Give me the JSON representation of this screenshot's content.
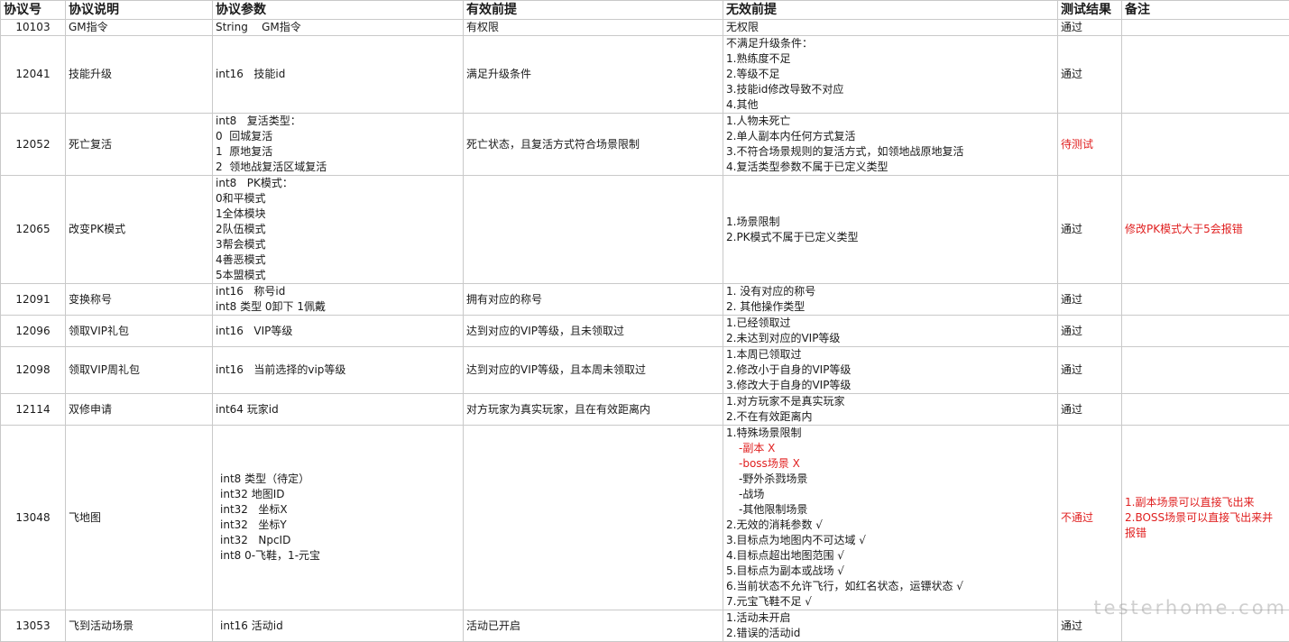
{
  "headers": [
    "协议号",
    "协议说明",
    "协议参数",
    "有效前提",
    "无效前提",
    "测试结果",
    "备注"
  ],
  "rows": [
    {
      "id": "10103",
      "desc": "GM指令",
      "params": [
        "String    GM指令"
      ],
      "valid": "有权限",
      "invalid": [
        "无权限"
      ],
      "result": "通过",
      "note": []
    },
    {
      "id": "12041",
      "desc": "技能升级",
      "params": [
        "int16   技能id"
      ],
      "valid": "满足升级条件",
      "invalid": [
        "不满足升级条件：",
        "1.熟练度不足",
        "2.等级不足",
        "3.技能id修改导致不对应",
        "4.其他"
      ],
      "result": "通过",
      "note": []
    },
    {
      "id": "12052",
      "desc": "死亡复活",
      "params": [
        "int8   复活类型：",
        "0  回城复活",
        "1  原地复活",
        "2  领地战复活区域复活"
      ],
      "valid": "死亡状态，且复活方式符合场景限制",
      "invalid": [
        "1.人物未死亡",
        "2.单人副本内任何方式复活",
        "3.不符合场景规则的复活方式，如领地战原地复活",
        "4.复活类型参数不属于已定义类型"
      ],
      "result": "待测试",
      "note": []
    },
    {
      "id": "12065",
      "desc": "改变PK模式",
      "params": [
        "int8   PK模式：",
        "0和平模式",
        "1全体模块",
        "2队伍模式",
        "3帮会模式",
        "4善恶模式",
        "5本盟模式"
      ],
      "valid": "",
      "invalid": [
        "1.场景限制",
        "2.PK模式不属于已定义类型"
      ],
      "result": "通过",
      "note": [
        "修改PK模式大于5会报错"
      ]
    },
    {
      "id": "12091",
      "desc": "变换称号",
      "params": [
        "int16   称号id",
        "int8 类型 0卸下 1佩戴"
      ],
      "valid": "拥有对应的称号",
      "invalid": [
        "1. 没有对应的称号",
        "2. 其他操作类型"
      ],
      "result": "通过",
      "note": []
    },
    {
      "id": "12096",
      "desc": "领取VIP礼包",
      "params": [
        "int16   VIP等级"
      ],
      "valid": "达到对应的VIP等级，且未领取过",
      "invalid": [
        "1.已经领取过",
        "2.未达到对应的VIP等级"
      ],
      "result": "通过",
      "note": []
    },
    {
      "id": "12098",
      "desc": "领取VIP周礼包",
      "params": [
        "int16   当前选择的vip等级"
      ],
      "valid": "达到对应的VIP等级，且本周未领取过",
      "invalid": [
        "1.本周已领取过",
        "2.修改小于自身的VIP等级",
        "3.修改大于自身的VIP等级"
      ],
      "result": "通过",
      "note": []
    },
    {
      "id": "12114",
      "desc": "双修申请",
      "params": [
        "int64 玩家id"
      ],
      "valid": "对方玩家为真实玩家，且在有效距离内",
      "invalid": [
        "1.对方玩家不是真实玩家",
        "2.不在有效距离内"
      ],
      "result": "通过",
      "note": []
    },
    {
      "id": "13048",
      "desc": "飞地图",
      "params": [
        "int8 类型（待定）",
        "int32 地图ID",
        "int32   坐标X",
        "int32   坐标Y",
        "int32   NpcID",
        "int8 0-飞鞋，1-元宝"
      ],
      "valid": "",
      "invalid": [
        "1.特殊场景限制",
        "-副本 X",
        "-boss场景 X",
        "-野外杀戮场景",
        "-战场",
        "-其他限制场景",
        "2.无效的消耗参数 √",
        "3.目标点为地图内不可达域 √",
        "4.目标点超出地图范围 √",
        "5.目标点为副本或战场 √",
        "6.当前状态不允许飞行，如红名状态，运镖状态 √",
        "7.元宝飞鞋不足 √"
      ],
      "result": "不通过",
      "note": [
        "1.副本场景可以直接飞出来",
        "2.BOSS场景可以直接飞出来并",
        "报错"
      ]
    },
    {
      "id": "13053",
      "desc": "飞到活动场景",
      "params": [
        "int16 活动id"
      ],
      "valid": "活动已开启",
      "invalid": [
        "1.活动未开启",
        "2.错误的活动id"
      ],
      "result": "通过",
      "note": []
    }
  ],
  "watermark": "testerhome.com"
}
